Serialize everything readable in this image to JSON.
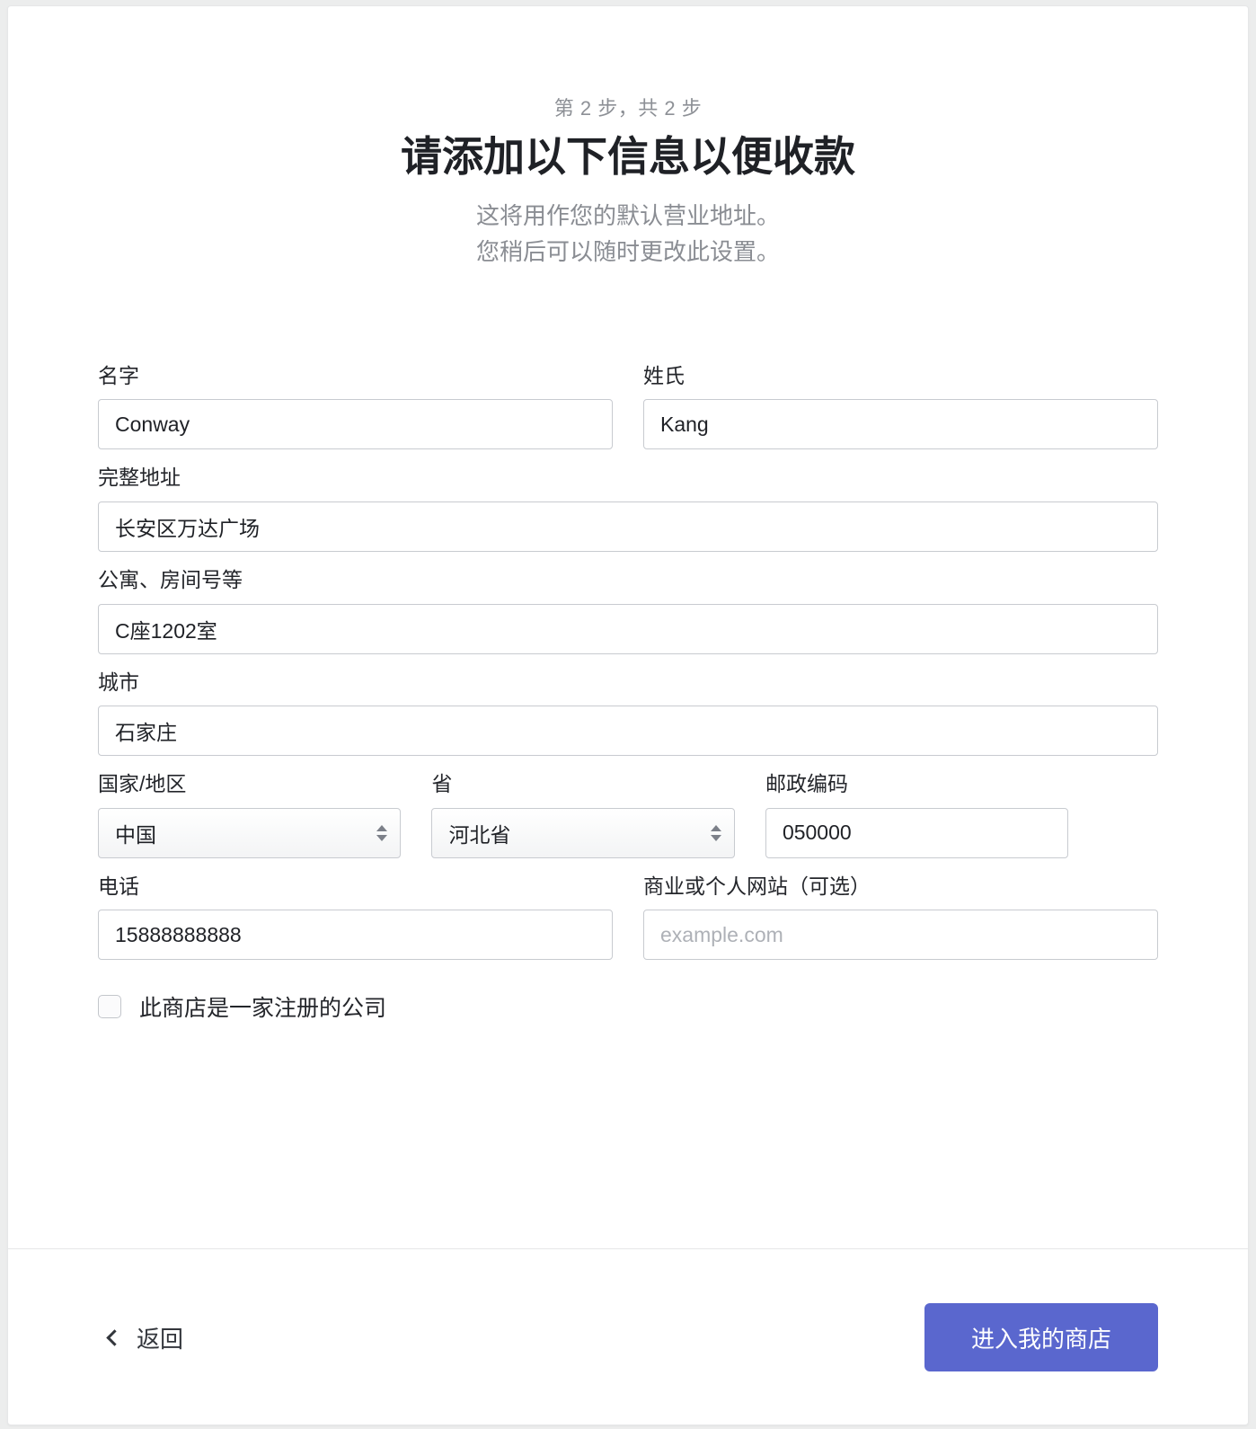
{
  "header": {
    "step_label": "第 2 步，共 2 步",
    "title": "请添加以下信息以便收款",
    "subtitle_line1": "这将用作您的默认营业地址。",
    "subtitle_line2": "您稍后可以随时更改此设置。"
  },
  "form": {
    "first_name": {
      "label": "名字",
      "value": "Conway"
    },
    "last_name": {
      "label": "姓氏",
      "value": "Kang"
    },
    "address": {
      "label": "完整地址",
      "value": "长安区万达广场"
    },
    "apartment": {
      "label": "公寓、房间号等",
      "value": "C座1202室"
    },
    "city": {
      "label": "城市",
      "value": "石家庄"
    },
    "country": {
      "label": "国家/地区",
      "value": "中国"
    },
    "province": {
      "label": "省",
      "value": "河北省"
    },
    "postal_code": {
      "label": "邮政编码",
      "value": "050000"
    },
    "phone": {
      "label": "电话",
      "value": "15888888888"
    },
    "website": {
      "label": "商业或个人网站（可选）",
      "value": "",
      "placeholder": "example.com"
    },
    "registered_company": {
      "label": "此商店是一家注册的公司",
      "checked": false
    }
  },
  "footer": {
    "back_label": "返回",
    "primary_label": "进入我的商店"
  },
  "colors": {
    "primary": "#5a67ce",
    "title": "#1f2126",
    "muted": "#8a8d93",
    "border": "#c8cbd0"
  }
}
